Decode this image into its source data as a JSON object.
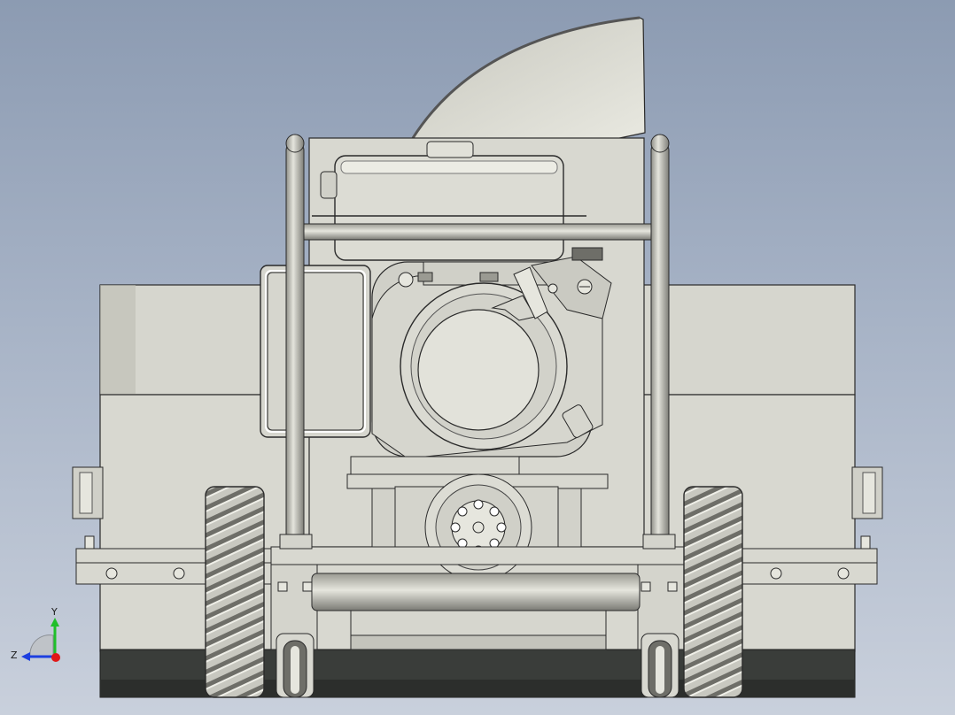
{
  "view": {
    "background_top": "#8c9bb2",
    "background_bottom": "#c9d0dc",
    "model_fill": "#d8d8d0",
    "model_stroke": "#2a2a2a",
    "shadow_fill": "#3a3d3a"
  },
  "triad": {
    "y_label": "Y",
    "z_label": "Z",
    "y_color": "#1fbf2a",
    "z_color": "#1d3fe0",
    "x_color": "#e01818"
  }
}
